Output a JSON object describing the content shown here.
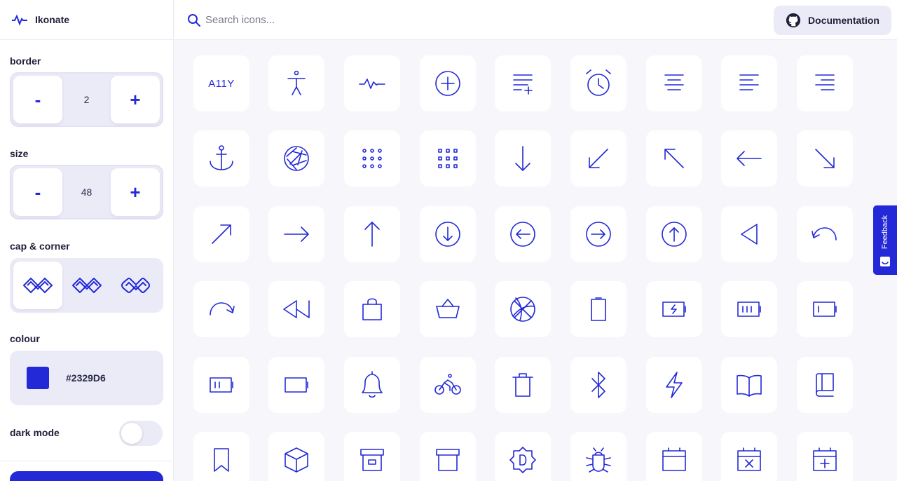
{
  "app": {
    "name": "Ikonate"
  },
  "search": {
    "placeholder": "Search icons..."
  },
  "header": {
    "documentation_label": "Documentation"
  },
  "controls": {
    "border": {
      "label": "border",
      "value": "2",
      "minus": "-",
      "plus": "+"
    },
    "size": {
      "label": "size",
      "value": "48",
      "minus": "-",
      "plus": "+"
    },
    "cap_corner": {
      "label": "cap & corner",
      "selected": "miter",
      "options": [
        "miter",
        "round",
        "square"
      ]
    },
    "colour": {
      "label": "colour",
      "hex": "#2329D6"
    },
    "dark_mode": {
      "label": "dark mode",
      "on": false
    }
  },
  "feedback": {
    "label": "Feedback"
  },
  "colors": {
    "accent": "#2329D6",
    "panel": "#ebebf8",
    "background": "#f6f6fb"
  },
  "icons": [
    "a11y-icon",
    "accessibility-icon",
    "activity-icon",
    "add-icon",
    "add-to-list-icon",
    "alarm-icon",
    "align-center-icon",
    "align-left-icon",
    "align-right-icon",
    "anchor-icon",
    "aperture-icon",
    "apps-icon",
    "apps-alt-icon",
    "arrow-down-icon",
    "arrow-down-left-icon",
    "arrow-up-left-icon",
    "arrow-left-icon",
    "arrow-down-right-icon",
    "arrow-up-right-icon",
    "arrow-right-icon",
    "arrow-up-icon",
    "arrow-down-circle-icon",
    "arrow-left-circle-icon",
    "arrow-right-circle-icon",
    "arrow-up-circle-icon",
    "back-icon",
    "rotate-left-icon",
    "rotate-right-icon",
    "rewind-icon",
    "bag-icon",
    "basket-icon",
    "basketball-icon",
    "battery-icon",
    "battery-charging-icon",
    "battery-75-icon",
    "battery-25-icon",
    "battery-50-icon",
    "battery-empty-icon",
    "bell-icon",
    "bicycle-icon",
    "bin-icon",
    "bluetooth-icon",
    "bolt-icon",
    "book-opened-icon",
    "book-icon",
    "bookmark-icon",
    "box-icon",
    "box-alt-icon",
    "box-archive-icon",
    "brightness-icon",
    "bug-icon",
    "calendar-icon",
    "calendar-remove-icon",
    "calendar-add-icon"
  ],
  "icon_text": {
    "a11y": "A11Y"
  }
}
